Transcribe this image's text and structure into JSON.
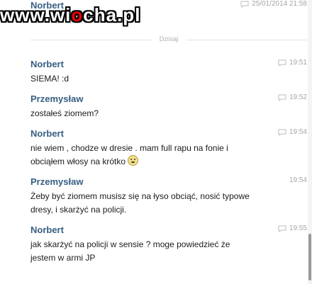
{
  "watermark": {
    "pre": "www.wi",
    "o": "o",
    "post": "cha.pl"
  },
  "divider_label": "Dzisiaj",
  "top_message": {
    "author": "Norbert",
    "time": "25/01/2014 21:58"
  },
  "messages": [
    {
      "author": "Norbert",
      "time": "19:51",
      "text": "SIEMA! :d"
    },
    {
      "author": "Przemysław",
      "time": "19:52",
      "text": "zostałeś ziomem?"
    },
    {
      "author": "Norbert",
      "time": "19:54",
      "line1": "nie wiem , chodze w dresie . mam full rapu na fonie i",
      "line2": "obciąłem włosy na krótko",
      "emoji": "worried-smiley"
    },
    {
      "author": "Przemysław",
      "time": "19:54",
      "line1": "Żeby być ziomem musisz się na łyso obciąć, nosić typowe",
      "line2": "dresy, i skarżyć na policji."
    },
    {
      "author": "Norbert",
      "time": "19:55",
      "line1": "jak skarżyć na policji w sensie ? moge powiedzieć że",
      "line2": "jestem w armi JP"
    }
  ],
  "icons": {
    "message": "chat-bubble-icon",
    "emoji": "worried-smiley-icon"
  }
}
